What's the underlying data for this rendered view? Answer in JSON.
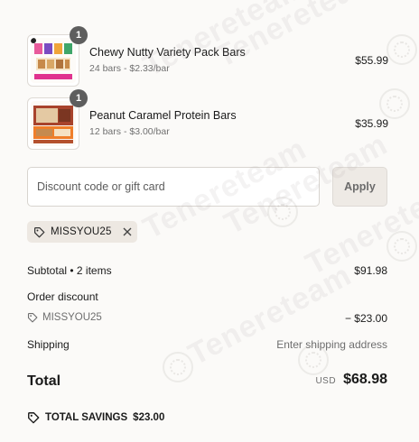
{
  "cart": {
    "items": [
      {
        "name": "Chewy Nutty Variety Pack Bars",
        "detail": "24 bars - $2.33/bar",
        "price": "$55.99",
        "quantity": "1"
      },
      {
        "name": "Peanut Caramel Protein Bars",
        "detail": "12 bars - $3.00/bar",
        "price": "$35.99",
        "quantity": "1"
      }
    ]
  },
  "discount": {
    "placeholder": "Discount code or gift card",
    "apply_label": "Apply",
    "applied_code": "MISSYOU25"
  },
  "summary": {
    "subtotal_label": "Subtotal • 2 items",
    "subtotal_value": "$91.98",
    "order_discount_label": "Order discount",
    "discount_code": "MISSYOU25",
    "discount_value": "− $23.00",
    "shipping_label": "Shipping",
    "shipping_value": "Enter shipping address",
    "total_label": "Total",
    "currency": "USD",
    "total_value": "$68.98",
    "savings_label": "TOTAL SAVINGS",
    "savings_value": "$23.00"
  },
  "watermark": {
    "text": "Tenereteam"
  },
  "colors": {
    "background": "#fbfaf8",
    "chip_background": "#ede8e2",
    "apply_background": "#eeeae5",
    "qty_badge": "#5e5e5e"
  },
  "icons": [
    "tag-icon",
    "close-icon"
  ]
}
